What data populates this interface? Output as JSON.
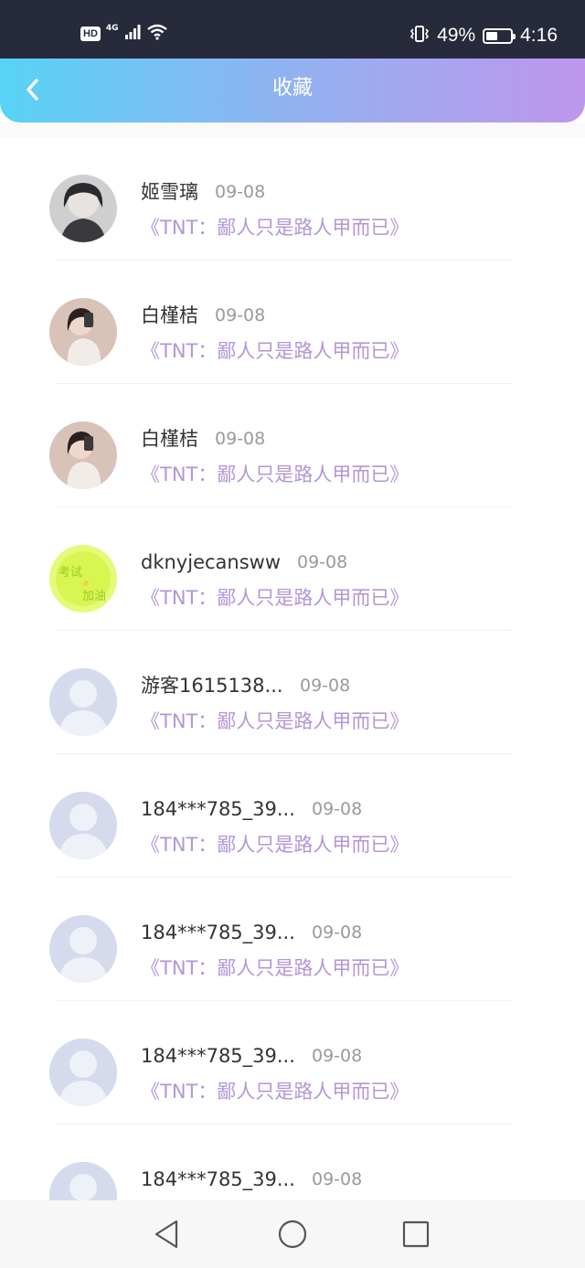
{
  "status_bar": {
    "hd": "HD",
    "network": "4G",
    "battery_text": "49%",
    "battery_level": 0.49,
    "time": "4:16",
    "icons": [
      "signal-icon",
      "wifi-icon",
      "vibrate-icon",
      "battery-icon"
    ]
  },
  "header": {
    "title": "收藏",
    "back_icon": "chevron-left-icon",
    "gradient": [
      "#58d3f5",
      "#be96ec"
    ]
  },
  "colors": {
    "book_title": "#b595d6",
    "date": "#9a9a9a",
    "name": "#333333"
  },
  "items": [
    {
      "name": "姬雪璃",
      "date": "09-08",
      "book": "《TNT：鄙人只是路人甲而已》",
      "avatar": "photo-dark-hair"
    },
    {
      "name": "白槿桔",
      "date": "09-08",
      "book": "《TNT：鄙人只是路人甲而已》",
      "avatar": "photo-selfie"
    },
    {
      "name": "白槿桔",
      "date": "09-08",
      "book": "《TNT：鄙人只是路人甲而已》",
      "avatar": "photo-selfie"
    },
    {
      "name": "dknyjecansww",
      "date": "09-08",
      "book": "《TNT：鄙人只是路人甲而已》",
      "avatar": "lime-text-badge"
    },
    {
      "name": "游客1615138...",
      "date": "09-08",
      "book": "《TNT：鄙人只是路人甲而已》",
      "avatar": "default-user"
    },
    {
      "name": "184***785_39...",
      "date": "09-08",
      "book": "《TNT：鄙人只是路人甲而已》",
      "avatar": "default-user"
    },
    {
      "name": "184***785_39...",
      "date": "09-08",
      "book": "《TNT：鄙人只是路人甲而已》",
      "avatar": "default-user"
    },
    {
      "name": "184***785_39...",
      "date": "09-08",
      "book": "《TNT：鄙人只是路人甲而已》",
      "avatar": "default-user"
    },
    {
      "name": "184***785_39...",
      "date": "09-08",
      "book": "",
      "avatar": "default-user"
    }
  ],
  "nav_bar": {
    "buttons": [
      "back-triangle-icon",
      "home-circle-icon",
      "recents-square-icon"
    ]
  }
}
